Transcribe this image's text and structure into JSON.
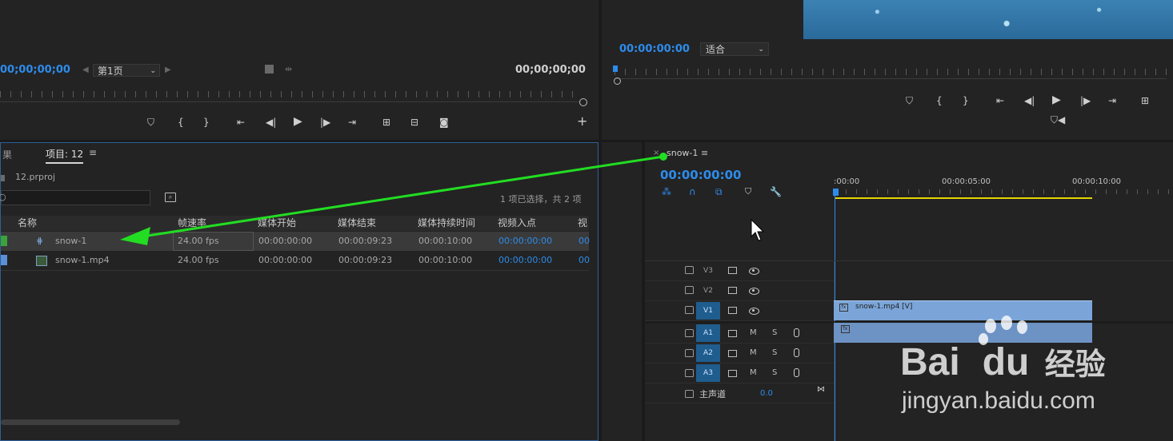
{
  "source_monitor": {
    "timecode_left": "00;00;00;00",
    "page_select": "第1页",
    "timecode_right": "00;00;00;00"
  },
  "program_monitor": {
    "timecode": "00:00:00:00",
    "fit_select": "适合"
  },
  "project_panel": {
    "tab_prev": "果",
    "tab_active": "项目: 12",
    "menu": "≡",
    "project_file": "12.prproj",
    "selection_info": "1 项已选择，共 2 项",
    "columns": [
      "名称",
      "帧速率",
      "媒体开始",
      "媒体结束",
      "媒体持续时间",
      "视频入点",
      "视"
    ],
    "rows": [
      {
        "name": "snow-1",
        "fps": "24.00 fps",
        "start": "00:00:00:00",
        "end": "00:00:09:23",
        "duration": "00:00:10:00",
        "in": "00:00:00:00",
        "extra": "00"
      },
      {
        "name": "snow-1.mp4",
        "fps": "24.00 fps",
        "start": "00:00:00:00",
        "end": "00:00:09:23",
        "duration": "00:00:10:00",
        "in": "00:00:00:00",
        "extra": "00"
      }
    ],
    "colors": {
      "sequence_label": "#3aa33a",
      "clip_label": "#5b8fd6"
    }
  },
  "timeline": {
    "close": "×",
    "sequence_name": "snow-1",
    "menu": "≡",
    "timecode": "00:00:00:00",
    "ruler": [
      ":00:00",
      "00:00:05:00",
      "00:00:10:00"
    ],
    "video_tracks": [
      "V3",
      "V2",
      "V1"
    ],
    "audio_tracks": [
      "A1",
      "A2",
      "A3"
    ],
    "mute": "M",
    "solo": "S",
    "master": "主声道",
    "master_value": "0.0",
    "clip_video": "snow-1.mp4 [V]",
    "clip_audio_icon": "fx"
  },
  "watermark": {
    "brand": "Bai",
    "brand2": "du",
    "cn": "经验",
    "url": "jingyan.baidu.com"
  }
}
